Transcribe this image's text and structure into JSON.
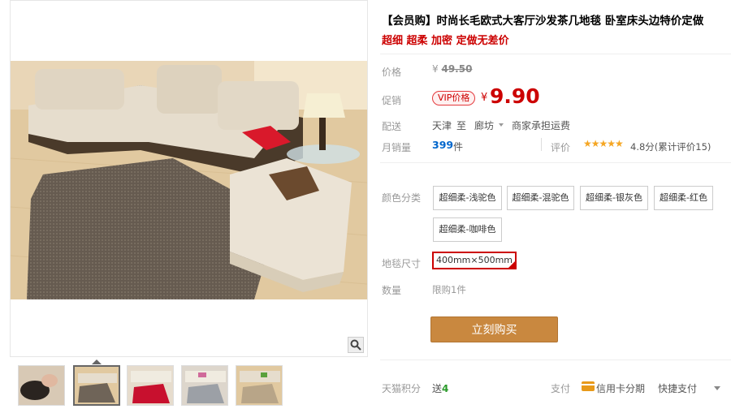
{
  "product": {
    "title": "【会员购】时尚长毛欧式大客厅沙发茶几地毯 卧室床头边特价定做",
    "subtitle": "超细 超柔 加密 定做无差价"
  },
  "price": {
    "label": "价格",
    "currency": "¥",
    "original": "49.50"
  },
  "promo": {
    "label": "促销",
    "badge": "VIP价格",
    "currency": "¥",
    "price": "9.90"
  },
  "shipping": {
    "label": "配送",
    "from": "天津",
    "to_word": "至",
    "dest": "廊坊",
    "note": "商家承担运费"
  },
  "sales": {
    "label": "月销量",
    "count": "399",
    "unit": "件",
    "rating_label": "评价",
    "stars": "★★★★★",
    "rating": "4.8分(累计评价15)"
  },
  "color": {
    "label": "颜色分类",
    "options": [
      "超细柔-浅驼色",
      "超细柔-混驼色",
      "超细柔-银灰色",
      "超细柔-红色",
      "超细柔-咖啡色"
    ]
  },
  "size": {
    "label": "地毯尺寸",
    "value": "400mm×500mm"
  },
  "quantity": {
    "label": "数量",
    "limit": "限购1件"
  },
  "buy": {
    "label": "立刻购买"
  },
  "footer": {
    "points_label": "天猫积分",
    "points_prefix": "送",
    "points_value": "4",
    "pay_label": "支付",
    "card_pay": "信用卡分期",
    "quick_pay": "快捷支付"
  },
  "icons": {
    "zoom": "magnifier-icon",
    "card": "credit-card-icon"
  },
  "colors": {
    "accent_red": "#cc0000",
    "buy_button": "#c9883f",
    "link_blue": "#0066cc",
    "star_yellow": "#f5a623"
  }
}
